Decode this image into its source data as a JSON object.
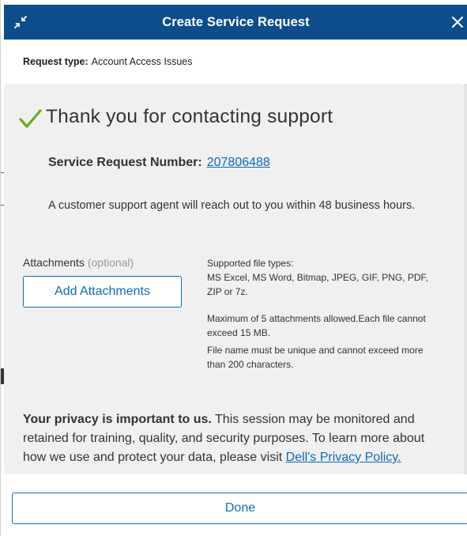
{
  "header": {
    "title": "Create Service Request"
  },
  "request_type": {
    "label": "Request type:",
    "value": "Account Access Issues"
  },
  "confirmation": {
    "heading": "Thank you for contacting support",
    "srn_label": "Service Request Number:",
    "srn_value": "207806488",
    "agent_message": "A customer support agent will reach out to you within 48 business hours."
  },
  "attachments": {
    "label": "Attachments",
    "optional": "(optional)",
    "button_label": "Add Attachments",
    "supported_label": "Supported file types:",
    "supported_types": "MS Excel, MS Word, Bitmap, JPEG, GIF, PNG, PDF, ZIP or 7z.",
    "max_note": "Maximum of 5 attachments allowed.Each file cannot exceed 15 MB.",
    "name_note": "File name must be unique and cannot exceed more than 200 characters."
  },
  "privacy": {
    "bold": "Your privacy is important to us.",
    "text": " This session may be monitored and retained for training, quality, and security purposes. To learn more about how we use and protect your data, please visit ",
    "link": "Dell's Privacy Policy."
  },
  "footer": {
    "done_label": "Done"
  },
  "colors": {
    "header_bg": "#0e4d8c",
    "accent": "#0e6bb8",
    "check": "#6aaa1e",
    "panel_bg": "#f0f0f0"
  },
  "icons": {
    "minimize": "collapse-arrows-icon",
    "close": "close-icon",
    "check": "checkmark-icon"
  }
}
